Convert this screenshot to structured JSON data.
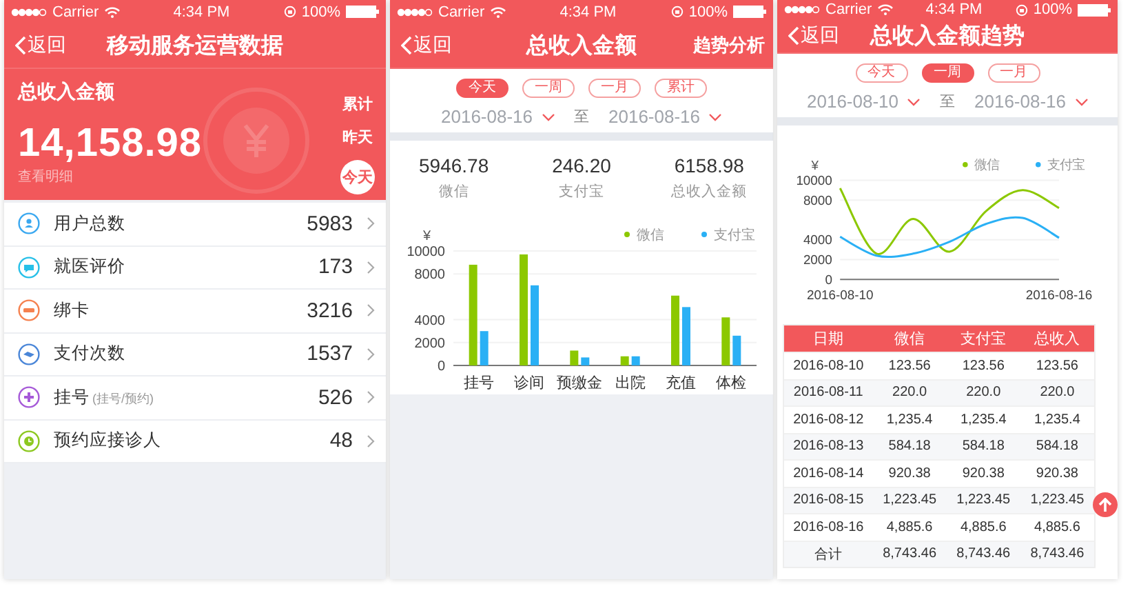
{
  "overview": {
    "status_bar": {
      "carrier": "Carrier",
      "time": "4:34 PM",
      "battery": "100%"
    },
    "nav": {
      "back": "返回",
      "title": "移动服务运营数据"
    },
    "hero": {
      "title": "总收入金额",
      "amount": "14,158.98",
      "link": "查看明细",
      "periods": [
        {
          "label": "累计",
          "selected": false
        },
        {
          "label": "昨天",
          "selected": false
        },
        {
          "label": "今天",
          "selected": true
        }
      ]
    },
    "items": [
      {
        "kind": "user",
        "color": "#3aa8f0",
        "label": "用户总数",
        "value": "5983"
      },
      {
        "kind": "chat",
        "color": "#27c0e8",
        "label": "就医评价",
        "value": "173"
      },
      {
        "kind": "card",
        "color": "#f5814f",
        "label": "绑卡",
        "value": "3216"
      },
      {
        "kind": "payment",
        "color": "#4a86d8",
        "label": "支付次数",
        "value": "1537"
      },
      {
        "kind": "plus",
        "color": "#a65ad8",
        "label": "挂号",
        "note": "(挂号/预约)",
        "value": "526"
      },
      {
        "kind": "clock",
        "color": "#8cc820",
        "label": "预约应接诊人",
        "value": "48"
      }
    ]
  },
  "income": {
    "status_bar": {
      "carrier": "Carrier",
      "time": "4:34 PM",
      "battery": "100%"
    },
    "nav": {
      "back": "返回",
      "title": "总收入金额",
      "action": "趋势分析"
    },
    "periods": [
      {
        "label": "今天",
        "selected": true
      },
      {
        "label": "一周",
        "selected": false
      },
      {
        "label": "一月",
        "selected": false
      },
      {
        "label": "累计",
        "selected": false
      }
    ],
    "date_range": {
      "from": "2016-08-16",
      "separator": "至",
      "to": "2016-08-16"
    },
    "stats": [
      {
        "value": "5946.78",
        "label": "微信"
      },
      {
        "value": "246.20",
        "label": "支付宝"
      },
      {
        "value": "6158.98",
        "label": "总收入金额"
      }
    ],
    "chart_data": {
      "type": "bar",
      "ylabel": "¥",
      "grid": true,
      "legend": true,
      "stacked": false,
      "categories": [
        "挂号",
        "诊间",
        "预缴金",
        "出院",
        "充值",
        "体检"
      ],
      "ylim": [
        0,
        10000
      ],
      "yticks": [
        0,
        2000,
        4000,
        8000,
        10000
      ],
      "series": [
        {
          "name": "微信",
          "color": "#8cc800",
          "values": [
            8800,
            9700,
            1300,
            800,
            6100,
            4200
          ]
        },
        {
          "name": "支付宝",
          "color": "#2ab0f5",
          "values": [
            3000,
            7000,
            700,
            800,
            5100,
            2600
          ]
        }
      ]
    }
  },
  "trend": {
    "status_bar": {
      "carrier": "Carrier",
      "time": "4:34 PM",
      "battery": "100%"
    },
    "nav": {
      "back": "返回",
      "title": "总收入金额趋势"
    },
    "periods": [
      {
        "label": "今天",
        "selected": false
      },
      {
        "label": "一周",
        "selected": true
      },
      {
        "label": "一月",
        "selected": false
      }
    ],
    "date_range": {
      "from": "2016-08-10",
      "separator": "至",
      "to": "2016-08-16"
    },
    "chart_data": {
      "type": "line",
      "ylabel": "¥",
      "grid": true,
      "legend": true,
      "x": [
        "2016-08-10",
        "2016-08-11",
        "2016-08-12",
        "2016-08-13",
        "2016-08-14",
        "2016-08-15",
        "2016-08-16"
      ],
      "xlim": [
        "2016-08-10",
        "2016-08-16"
      ],
      "xticks": [
        "2016-08-10",
        "2016-08-16"
      ],
      "ylim": [
        0,
        10000
      ],
      "yticks": [
        0,
        2000,
        4000,
        8000,
        10000
      ],
      "series": [
        {
          "name": "微信",
          "color": "#8cc800",
          "values": [
            9200,
            2600,
            6100,
            2800,
            6900,
            9000,
            7200
          ]
        },
        {
          "name": "支付宝",
          "color": "#2ab0f5",
          "values": [
            4300,
            2400,
            2600,
            3800,
            5600,
            6200,
            4200
          ]
        }
      ]
    },
    "table": {
      "columns": [
        "日期",
        "微信",
        "支付宝",
        "总收入"
      ],
      "rows": [
        [
          "2016-08-10",
          "123.56",
          "123.56",
          "123.56"
        ],
        [
          "2016-08-11",
          "220.0",
          "220.0",
          "220.0"
        ],
        [
          "2016-08-12",
          "1,235.4",
          "1,235.4",
          "1,235.4"
        ],
        [
          "2016-08-13",
          "584.18",
          "584.18",
          "584.18"
        ],
        [
          "2016-08-14",
          "920.38",
          "920.38",
          "920.38"
        ],
        [
          "2016-08-15",
          "1,223.45",
          "1,223.45",
          "1,223.45"
        ],
        [
          "2016-08-16",
          "4,885.6",
          "4,885.6",
          "4,885.6"
        ]
      ],
      "total": [
        "合计",
        "8,743.46",
        "8,743.46",
        "8,743.46"
      ]
    }
  }
}
